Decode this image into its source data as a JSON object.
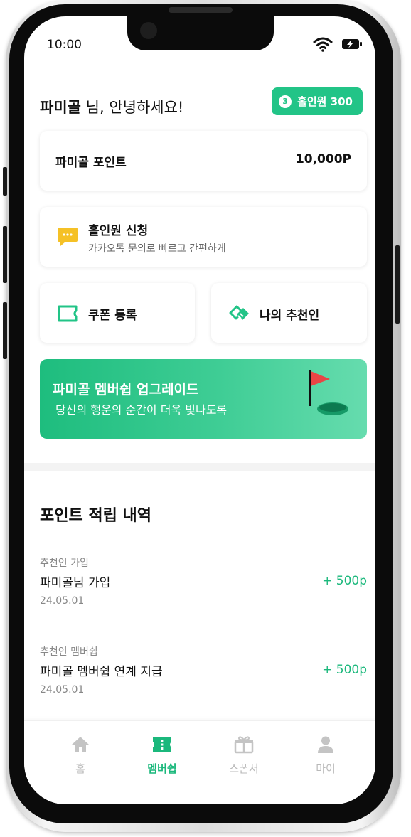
{
  "status": {
    "time": "10:00"
  },
  "greeting": {
    "name": "파미골",
    "suffix": "님, 안녕하세요!"
  },
  "badge": {
    "coin": "3",
    "label": "홀인원 300"
  },
  "points": {
    "label": "파미골 포인트",
    "value": "10,000P"
  },
  "apply": {
    "title": "홀인원 신청",
    "subtitle": "카카오톡 문의로 빠르고 간편하게"
  },
  "actions": {
    "coupon": "쿠폰 등록",
    "referrer": "나의 추천인"
  },
  "banner": {
    "title": "파미골 멤버쉽  업그레이드",
    "subtitle": "당신의 행운의 순간이 더욱 빛나도록"
  },
  "history": {
    "title": "포인트 적립 내역",
    "items": [
      {
        "category": "추천인 가입",
        "title": "파미골님 가입",
        "date": "24.05.01",
        "amount": "+ 500p"
      },
      {
        "category": "추천인 멤버쉽",
        "title": "파미골 멤버쉽 연계 지급",
        "date": "24.05.01",
        "amount": "+ 500p"
      }
    ]
  },
  "tabs": [
    {
      "label": "홈",
      "icon": "home-icon"
    },
    {
      "label": "멤버쉽",
      "icon": "ticket-icon",
      "active": true
    },
    {
      "label": "스폰서",
      "icon": "gift-icon"
    },
    {
      "label": "마이",
      "icon": "person-icon"
    }
  ],
  "colors": {
    "accent": "#1bb87c",
    "badge": "#22c487"
  }
}
